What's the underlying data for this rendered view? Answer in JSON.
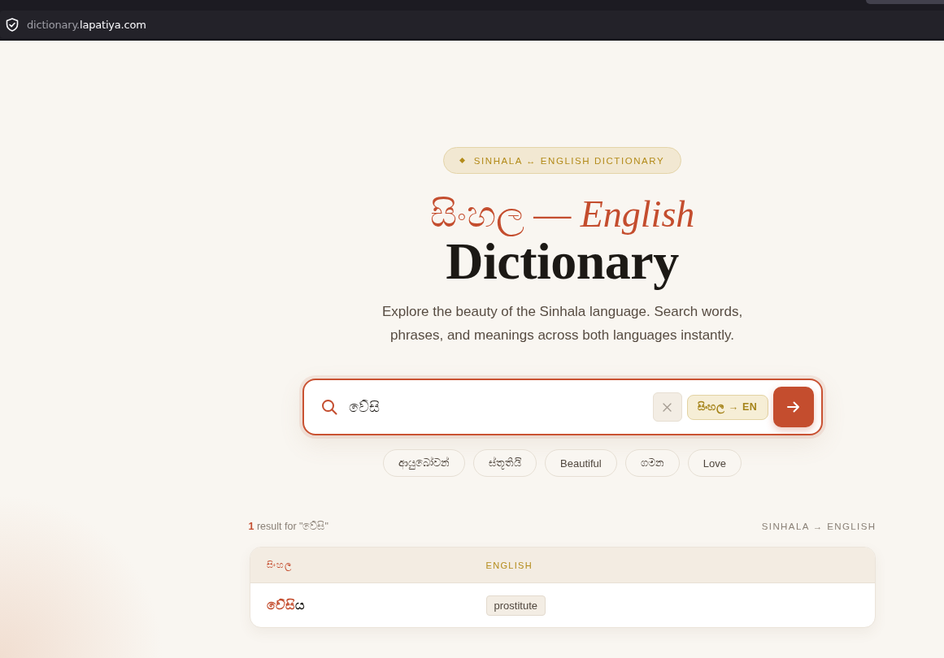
{
  "browser": {
    "url": "dictionary.**lapatiya.com**"
  },
  "hero": {
    "badge": "SINHALA ↔ ENGLISH DICTIONARY",
    "title_line_1": "සිංහල — *English*",
    "title_line_2": "Dictionary",
    "subtitle": "Explore the beauty of the Sinhala language. Search words, phrases, and meanings across both languages instantly."
  },
  "search": {
    "value": "වේසි",
    "direction": "සිංහල → EN"
  },
  "suggestions": [
    "ආයුබෝවන්",
    "ස්තූතියි",
    "Beautiful",
    "ගමන",
    "Love"
  ],
  "results": {
    "summary": "**1** result for \"වේසි\"",
    "direction": "SINHALA → ENGLISH",
    "columns": [
      "සිංහල",
      "ENGLISH"
    ],
    "rows": [
      {
        "word": "**වේසි**ය",
        "meanings": [
          "prostitute"
        ]
      }
    ]
  }
}
